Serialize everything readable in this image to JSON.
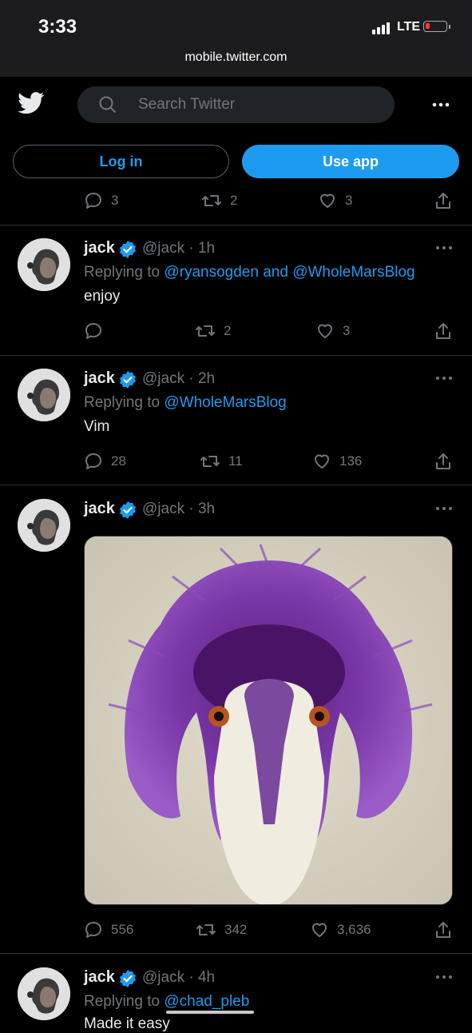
{
  "status_bar": {
    "time": "3:33",
    "network": "LTE"
  },
  "browser": {
    "url": "mobile.twitter.com"
  },
  "header": {
    "search_placeholder": "Search Twitter",
    "login_label": "Log in",
    "use_app_label": "Use app"
  },
  "top_actions": {
    "replies": "3",
    "retweets": "2",
    "likes": "3"
  },
  "tweets": [
    {
      "name": "jack",
      "handle": "@jack · 1h",
      "replying_prefix": "Replying to ",
      "replying_users": [
        "@ryansogden",
        "@WholeMarsBlog"
      ],
      "replying_joiner": " and ",
      "text": "enjoy",
      "replies": "",
      "retweets": "2",
      "likes": "3"
    },
    {
      "name": "jack",
      "handle": "@jack · 2h",
      "replying_prefix": "Replying to ",
      "replying_users": [
        "@WholeMarsBlog"
      ],
      "text": "Vim",
      "replies": "28",
      "retweets": "11",
      "likes": "136"
    },
    {
      "name": "jack",
      "handle": "@jack · 3h",
      "media": "purple feathered bird illustration",
      "replies": "556",
      "retweets": "342",
      "likes": "3,636"
    },
    {
      "name": "jack",
      "handle": "@jack · 4h",
      "replying_prefix": "Replying to ",
      "replying_users": [
        "@chad_pleb"
      ],
      "text": "Made it easy"
    }
  ],
  "colors": {
    "accent": "#1d9bf0",
    "muted": "#71767b",
    "background": "#000000"
  }
}
